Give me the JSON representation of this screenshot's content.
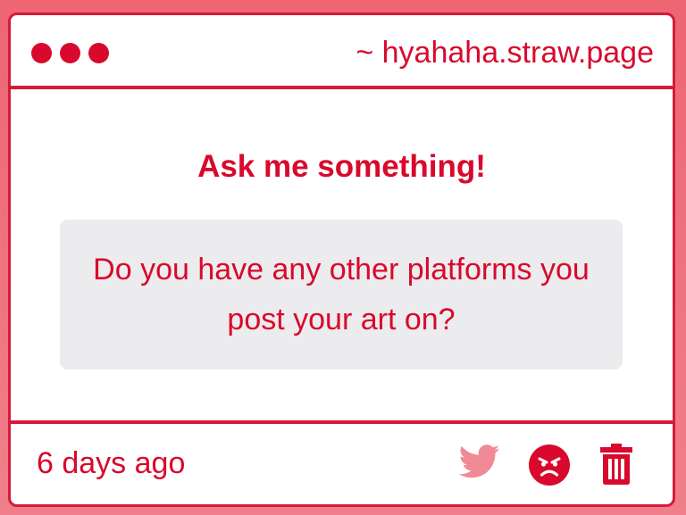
{
  "titlebar": {
    "site_url": "~ hyahaha.straw.page"
  },
  "content": {
    "heading": "Ask me something!",
    "question": "Do you have any other platforms you post your art on?"
  },
  "footer": {
    "timestamp": "6 days ago",
    "actions": [
      {
        "icon": "twitter-icon",
        "color": "#f08a96"
      },
      {
        "icon": "angry-face-icon",
        "color": "#d8092c"
      },
      {
        "icon": "trash-icon",
        "color": "#d8092c"
      }
    ]
  },
  "colors": {
    "accent": "#d8092c",
    "border": "#d61b3a",
    "question_bg": "#ecebed",
    "page_bg": "#ee6573"
  }
}
